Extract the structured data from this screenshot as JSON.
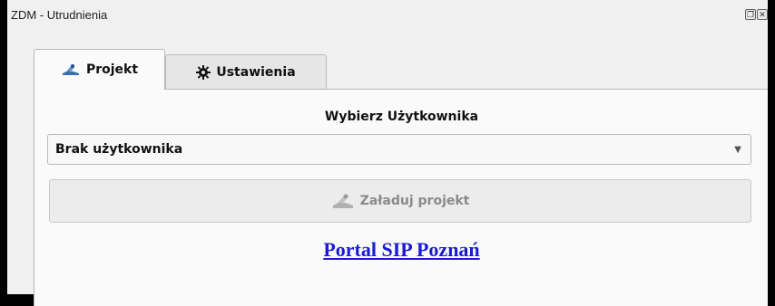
{
  "window": {
    "title": "ZDM - Utrudnienia"
  },
  "tabs": [
    {
      "label": "Projekt",
      "icon": "project-icon",
      "active": true
    },
    {
      "label": "Ustawienia",
      "icon": "gear-icon",
      "active": false
    }
  ],
  "project": {
    "section_label": "Wybierz  Użytkownika",
    "user_select": {
      "selected": "Brak użytkownika"
    },
    "load_button": {
      "label": "Załaduj projekt",
      "enabled": false,
      "icon": "project-icon"
    },
    "portal_link": {
      "label": "Portal SIP Poznań"
    }
  },
  "colors": {
    "link": "#1a1ad6",
    "background": "#f0f0f0"
  }
}
